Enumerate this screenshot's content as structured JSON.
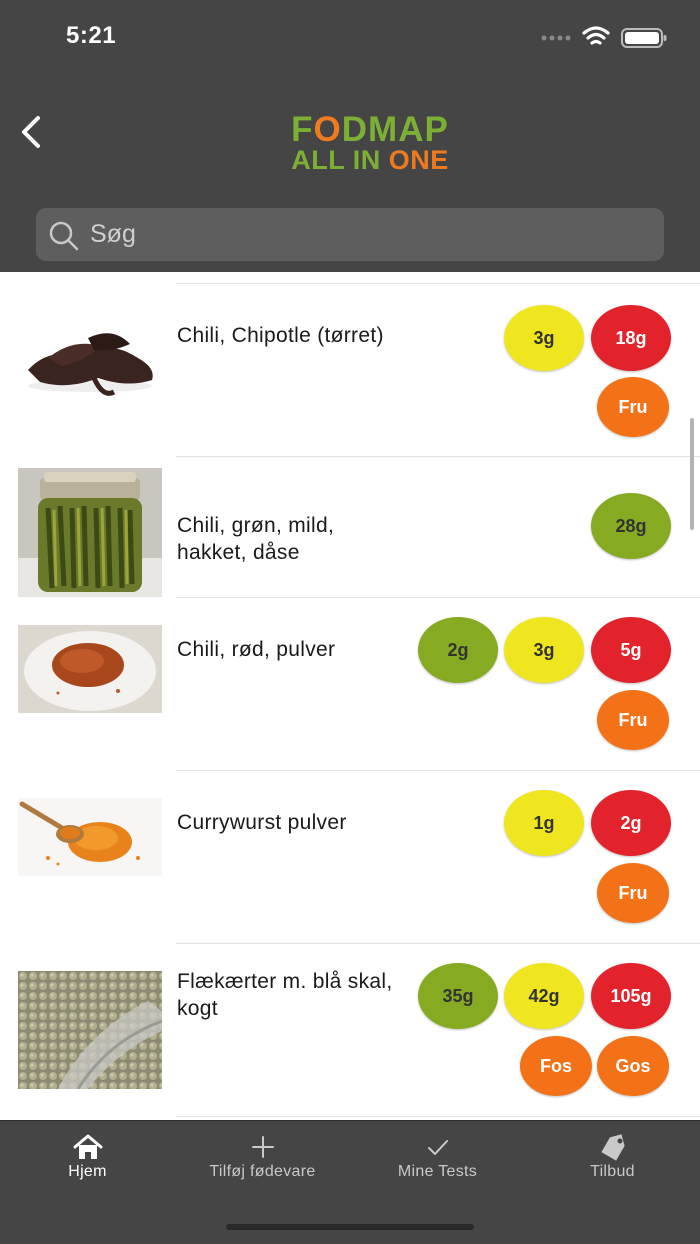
{
  "status_bar": {
    "time": "5:21"
  },
  "header": {
    "logo_line1_part1": "F",
    "logo_line1_o": "O",
    "logo_line1_part2": "DMAP",
    "logo_line2_part1": "ALL IN ",
    "logo_line2_part2": "ONE"
  },
  "search": {
    "placeholder": "Søg",
    "value": ""
  },
  "foods": [
    {
      "name": "Chili, Chipotle (tørret)",
      "amounts": [
        {
          "value": "3g",
          "color": "yellow"
        },
        {
          "value": "18g",
          "color": "red"
        }
      ],
      "tags": [
        "Fru"
      ]
    },
    {
      "name": "Chili, grøn, mild, hakket, dåse",
      "amounts": [
        {
          "value": "28g",
          "color": "green"
        }
      ],
      "tags": []
    },
    {
      "name": "Chili, rød, pulver",
      "amounts": [
        {
          "value": "2g",
          "color": "green"
        },
        {
          "value": "3g",
          "color": "yellow"
        },
        {
          "value": "5g",
          "color": "red"
        }
      ],
      "tags": [
        "Fru"
      ]
    },
    {
      "name": "Currywurst pulver",
      "amounts": [
        {
          "value": "1g",
          "color": "yellow"
        },
        {
          "value": "2g",
          "color": "red"
        }
      ],
      "tags": [
        "Fru"
      ]
    },
    {
      "name": "Flækærter m. blå skal, kogt",
      "amounts": [
        {
          "value": "35g",
          "color": "green"
        },
        {
          "value": "42g",
          "color": "yellow"
        },
        {
          "value": "105g",
          "color": "red"
        }
      ],
      "tags": [
        "Fos",
        "Gos"
      ]
    }
  ],
  "tabs": [
    {
      "label": "Hjem",
      "icon": "home-icon",
      "active": true
    },
    {
      "label": "Tilføj fødevare",
      "icon": "plus-icon",
      "active": false
    },
    {
      "label": "Mine Tests",
      "icon": "check-icon",
      "active": false
    },
    {
      "label": "Tilbud",
      "icon": "tag-icon",
      "active": false
    }
  ],
  "colors": {
    "header_bg": "#454545",
    "green": "#86aa21",
    "yellow": "#efe620",
    "red": "#e2232b",
    "orange": "#f37217"
  }
}
